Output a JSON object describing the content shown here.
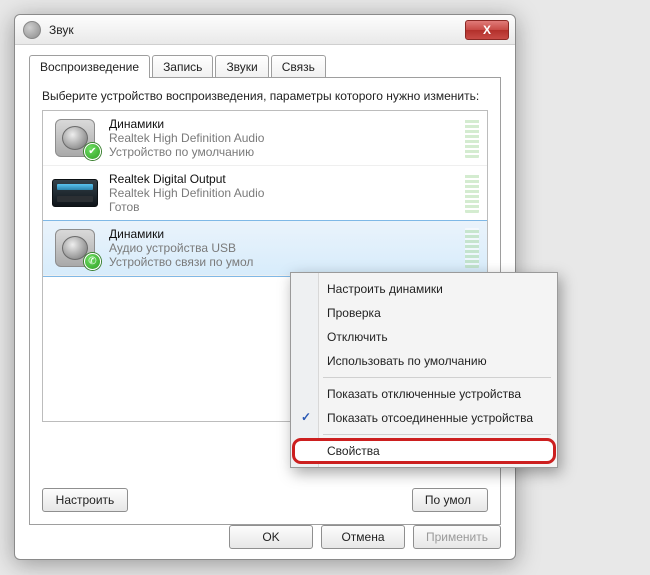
{
  "window": {
    "title": "Звук"
  },
  "tabs": [
    "Воспроизведение",
    "Запись",
    "Звуки",
    "Связь"
  ],
  "active_tab": 0,
  "hint": "Выберите устройство воспроизведения, параметры которого нужно изменить:",
  "devices": [
    {
      "name": "Динамики",
      "desc": "Realtek High Definition Audio",
      "state": "Устройство по умолчанию",
      "icon": "speaker",
      "badge": "default",
      "selected": false
    },
    {
      "name": "Realtek Digital Output",
      "desc": "Realtek High Definition Audio",
      "state": "Готов",
      "icon": "spdif",
      "badge": null,
      "selected": false
    },
    {
      "name": "Динамики",
      "desc": "Аудио устройства USB",
      "state": "Устройство связи по умол",
      "icon": "speaker",
      "badge": "tel",
      "selected": true
    }
  ],
  "panel_buttons": {
    "configure": "Настроить",
    "default": "По умол",
    "properties_cut": ""
  },
  "dialog_buttons": {
    "ok": "OK",
    "cancel": "Отмена",
    "apply": "Применить"
  },
  "context_menu": {
    "items": [
      {
        "label": "Настроить динамики",
        "checked": false
      },
      {
        "label": "Проверка",
        "checked": false
      },
      {
        "label": "Отключить",
        "checked": false
      },
      {
        "label": "Использовать по умолчанию",
        "checked": false
      }
    ],
    "items2": [
      {
        "label": "Показать отключенные устройства",
        "checked": false
      },
      {
        "label": "Показать отсоединенные устройства",
        "checked": true
      }
    ],
    "properties": "Свойства"
  }
}
